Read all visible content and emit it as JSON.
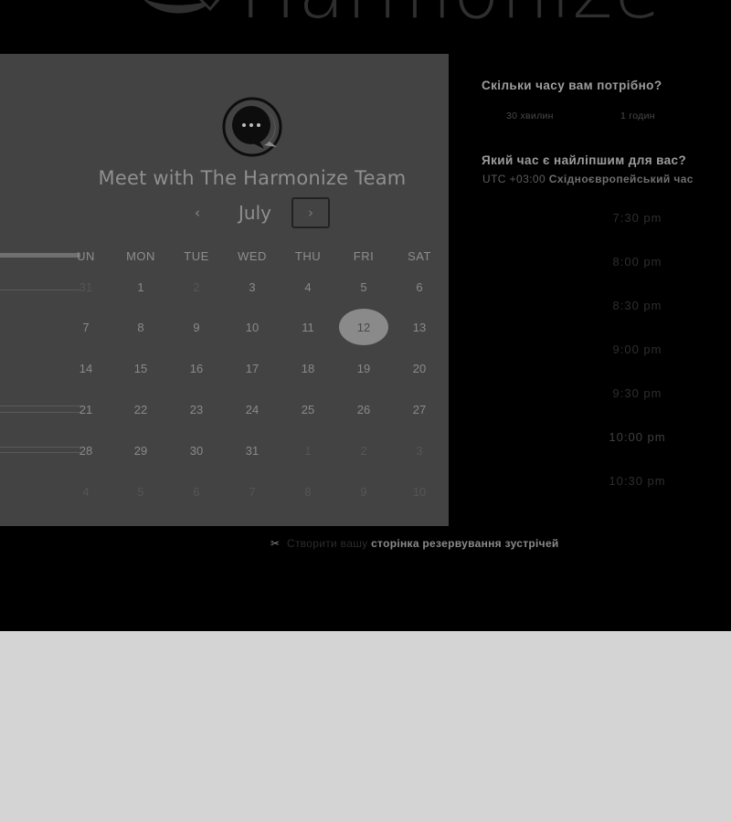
{
  "header": {
    "brand_text": "Harmonize"
  },
  "panel": {
    "title": "Meet with The Harmonize Team",
    "month": "July",
    "prev_icon": "chevron-left-icon",
    "next_icon": "chevron-right-icon",
    "prev_glyph": "‹",
    "next_glyph": "›",
    "weekdays": [
      "UN",
      "MON",
      "TUE",
      "WED",
      "THU",
      "FRI",
      "SAT"
    ],
    "weeks": [
      [
        "31",
        "1",
        "2",
        "3",
        "4",
        "5",
        "6"
      ],
      [
        "7",
        "8",
        "9",
        "10",
        "11",
        "12",
        "13"
      ],
      [
        "14",
        "15",
        "16",
        "17",
        "18",
        "19",
        "20"
      ],
      [
        "21",
        "22",
        "23",
        "24",
        "25",
        "26",
        "27"
      ],
      [
        "28",
        "29",
        "30",
        "31",
        "1",
        "2",
        "3"
      ],
      [
        "4",
        "5",
        "6",
        "7",
        "8",
        "9",
        "10"
      ]
    ],
    "selected_day": "12"
  },
  "booking": {
    "duration_question": "Скільки часу вам потрібно?",
    "durations": [
      "30 хвилин",
      "1 годин"
    ],
    "time_question": "Який час є найліпшим для вас?",
    "tz_offset": "UTC +03:00",
    "tz_name": "Східноєвропейський час",
    "slots": [
      "7:30 pm",
      "8:00 pm",
      "8:30 pm",
      "9:00 pm",
      "9:30 pm",
      "10:00 pm",
      "10:30 pm"
    ]
  },
  "footer": {
    "icon": "scissors-icon",
    "prefix": "Створити вашу",
    "link": "сторінка резервування зустрічей"
  },
  "colors": {
    "page_background": "#d4d4d4",
    "dark_background": "#000000",
    "panel_background": "#434343",
    "selected_day": "#8a8a8a"
  }
}
